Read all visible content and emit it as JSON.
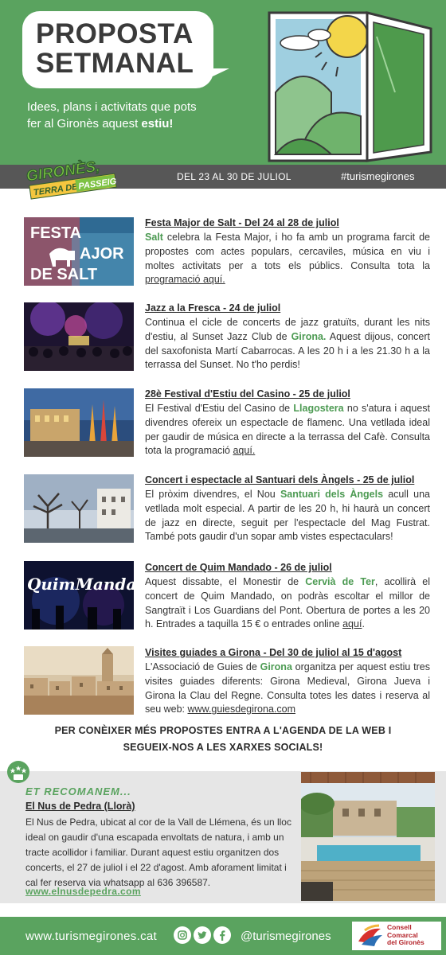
{
  "header": {
    "title_line1": "PROPOSTA",
    "title_line2": "SETMANAL",
    "intro_prefix": "Idees, plans i activitats que pots fer al Gironès aquest ",
    "intro_bold": "estiu!"
  },
  "strip": {
    "logo_line1": "GIRONÈS,",
    "logo_line2a": "TERRA DE",
    "logo_line2b": "PASSEIG",
    "dates": "DEL 23 AL 30 DE JULIOL",
    "hashtag": "#turismegirones"
  },
  "events": [
    {
      "title": "Festa Major de Salt - Del 24 al 28 de juliol",
      "image_text_1": "FESTA",
      "image_text_2": "AJOR",
      "image_text_3": "DE SALT",
      "p1_hl": "Salt",
      "p1": " celebra la Festa Major, i ho fa amb un programa farcit de propostes com actes populars, cercaviles, música en viu i moltes activitats per a tots els públics. Consulta tota la ",
      "p1_link": "programació aquí."
    },
    {
      "title": "Jazz a la Fresca - 24 de juliol",
      "p1": "Continua el cicle de concerts de jazz gratuïts, durant les nits d'estiu, al Sunset Jazz Club de ",
      "p1_hl": "Girona.",
      "p2": " Aquest dijous, concert del saxofonista Martí Cabarrocas. A les 20 h i a les 21.30 h a la terrassa del Sunset. No t'ho perdis!"
    },
    {
      "title": "28è Festival d'Estiu del Casino - 25 de juliol",
      "p1": "El Festival d'Estiu del Casino de ",
      "p1_hl": "Llagostera",
      "p2": " no s'atura i aquest divendres ofereix un espectacle de flamenc. Una vetllada ideal  per gaudir de música en directe a la terrassa del Cafè. Consulta tota la programació ",
      "p2_link": "aquí."
    },
    {
      "title": "Concert i espectacle al Santuari dels Àngels - 25 de juliol",
      "p1": "El pròxim divendres, el Nou ",
      "p1_hl": "Santuari dels Àngels",
      "p2": " acull una vetllada molt especial. A partir de les 20 h, hi haurà un concert de jazz en directe, seguit per l'espectacle del Mag Fustrat. També pots gaudir d'un sopar amb vistes espectaculars!"
    },
    {
      "title": "Concert de Quim Mandado - 26 de juliol",
      "image_text": "QuimMandad",
      "p1": "Aquest dissabte, el Monestir de ",
      "p1_hl": "Cervià de Ter",
      "p2": ", acollirà el concert de Quim Mandado, on podràs escoltar el millor de Sangtraït i Los Guardians del Pont. Obertura de portes a les 20 h. Entrades a taquilla 15 € o entrades online ",
      "p2_link": "aquí",
      "p3": "."
    },
    {
      "title": "Visites guiades a Girona - Del 30 de juliol al 15 d'agost",
      "p1": "L'Associació de Guies de ",
      "p1_hl": "Girona",
      "p2": " organitza per aquest estiu tres visites guiades diferents: Girona Medieval, Girona Jueva i Girona la Clau del Regne. Consulta totes les dates i reserva al seu web: ",
      "p2_link": "www.guiesdegirona.com"
    }
  ],
  "cta": {
    "line1": "PER CONÈIXER MÉS PROPOSTES ENTRA A L'AGENDA DE LA WEB I",
    "line2": "SEGUEIX-NOS A LES XARXES SOCIALS!"
  },
  "recommend": {
    "kicker": "ET RECOMANEM...",
    "title": "El Nus de Pedra (Llorà)",
    "description": "El Nus de Pedra, ubicat al cor de la Vall de Llémena, és un lloc ideal on gaudir d'una escapada envoltats de natura, i amb un tracte acollidor i familiar. Durant aquest estiu organitzen dos concerts, el 27 de juliol i el 22 d'agost. Amb aforament limitat i cal fer reserva via whatsapp al 636 396587.",
    "link": "www.elnusdepedra.com"
  },
  "footer": {
    "url": "www.turismegirones.cat",
    "handle": "@turismegirones",
    "council_line1": "Consell",
    "council_line2": "Comarcal",
    "council_line3": "del Gironès"
  },
  "colors": {
    "brand_green": "#5aa35f",
    "strip_gray": "#575757",
    "panel_gray": "#e6e6e6",
    "council_red": "#b4232a"
  },
  "icons": [
    "instagram-icon",
    "twitter-icon",
    "facebook-icon",
    "open-window-illustration",
    "council-logo"
  ]
}
